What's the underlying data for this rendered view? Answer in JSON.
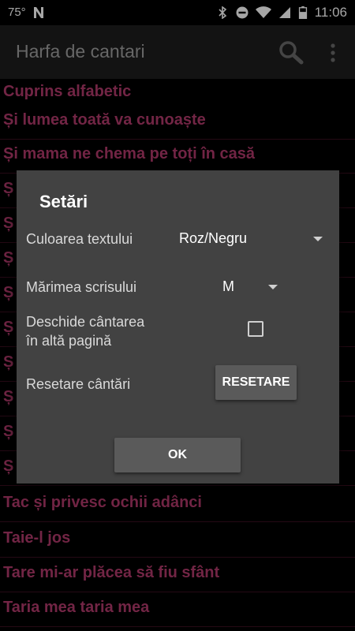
{
  "status_bar": {
    "temperature": "75°",
    "time": "11:06",
    "icons": [
      "n-notification-icon",
      "bluetooth-icon",
      "do-not-disturb-icon",
      "wifi-icon",
      "signal-icon",
      "battery-icon"
    ]
  },
  "app_bar": {
    "title": "Harfa de cantari",
    "icons": [
      "search-icon",
      "more-vert-icon"
    ]
  },
  "list": {
    "header": "Cuprins alfabetic",
    "items": [
      "Și lumea toată va cunoaște",
      "Și mama ne chema pe toți în casă",
      "Ș",
      "Ș",
      "Ș",
      "Ș",
      "Ș",
      "Ș",
      "Ș",
      "Ș",
      "Ș",
      "Tac și privesc ochii adânci",
      "Taie-l jos",
      "Tare mi-ar plăcea să fiu sfânt",
      "Taria mea taria mea"
    ]
  },
  "dialog": {
    "title": "Setări",
    "text_color_label": "Culoarea textului",
    "text_color_value": "Roz/Negru",
    "font_size_label": "Mărimea scrisului",
    "font_size_value": "M",
    "open_song_label_line1": "Deschide cântarea",
    "open_song_label_line2": "în altă pagină",
    "open_song_checked": false,
    "reset_label": "Resetare cântări",
    "reset_button": "RESETARE",
    "ok_button": "OK"
  },
  "colors": {
    "accent": "#b03a6a",
    "background": "#000000",
    "dialog": "#424242",
    "app_bar": "#1e1e1e"
  }
}
